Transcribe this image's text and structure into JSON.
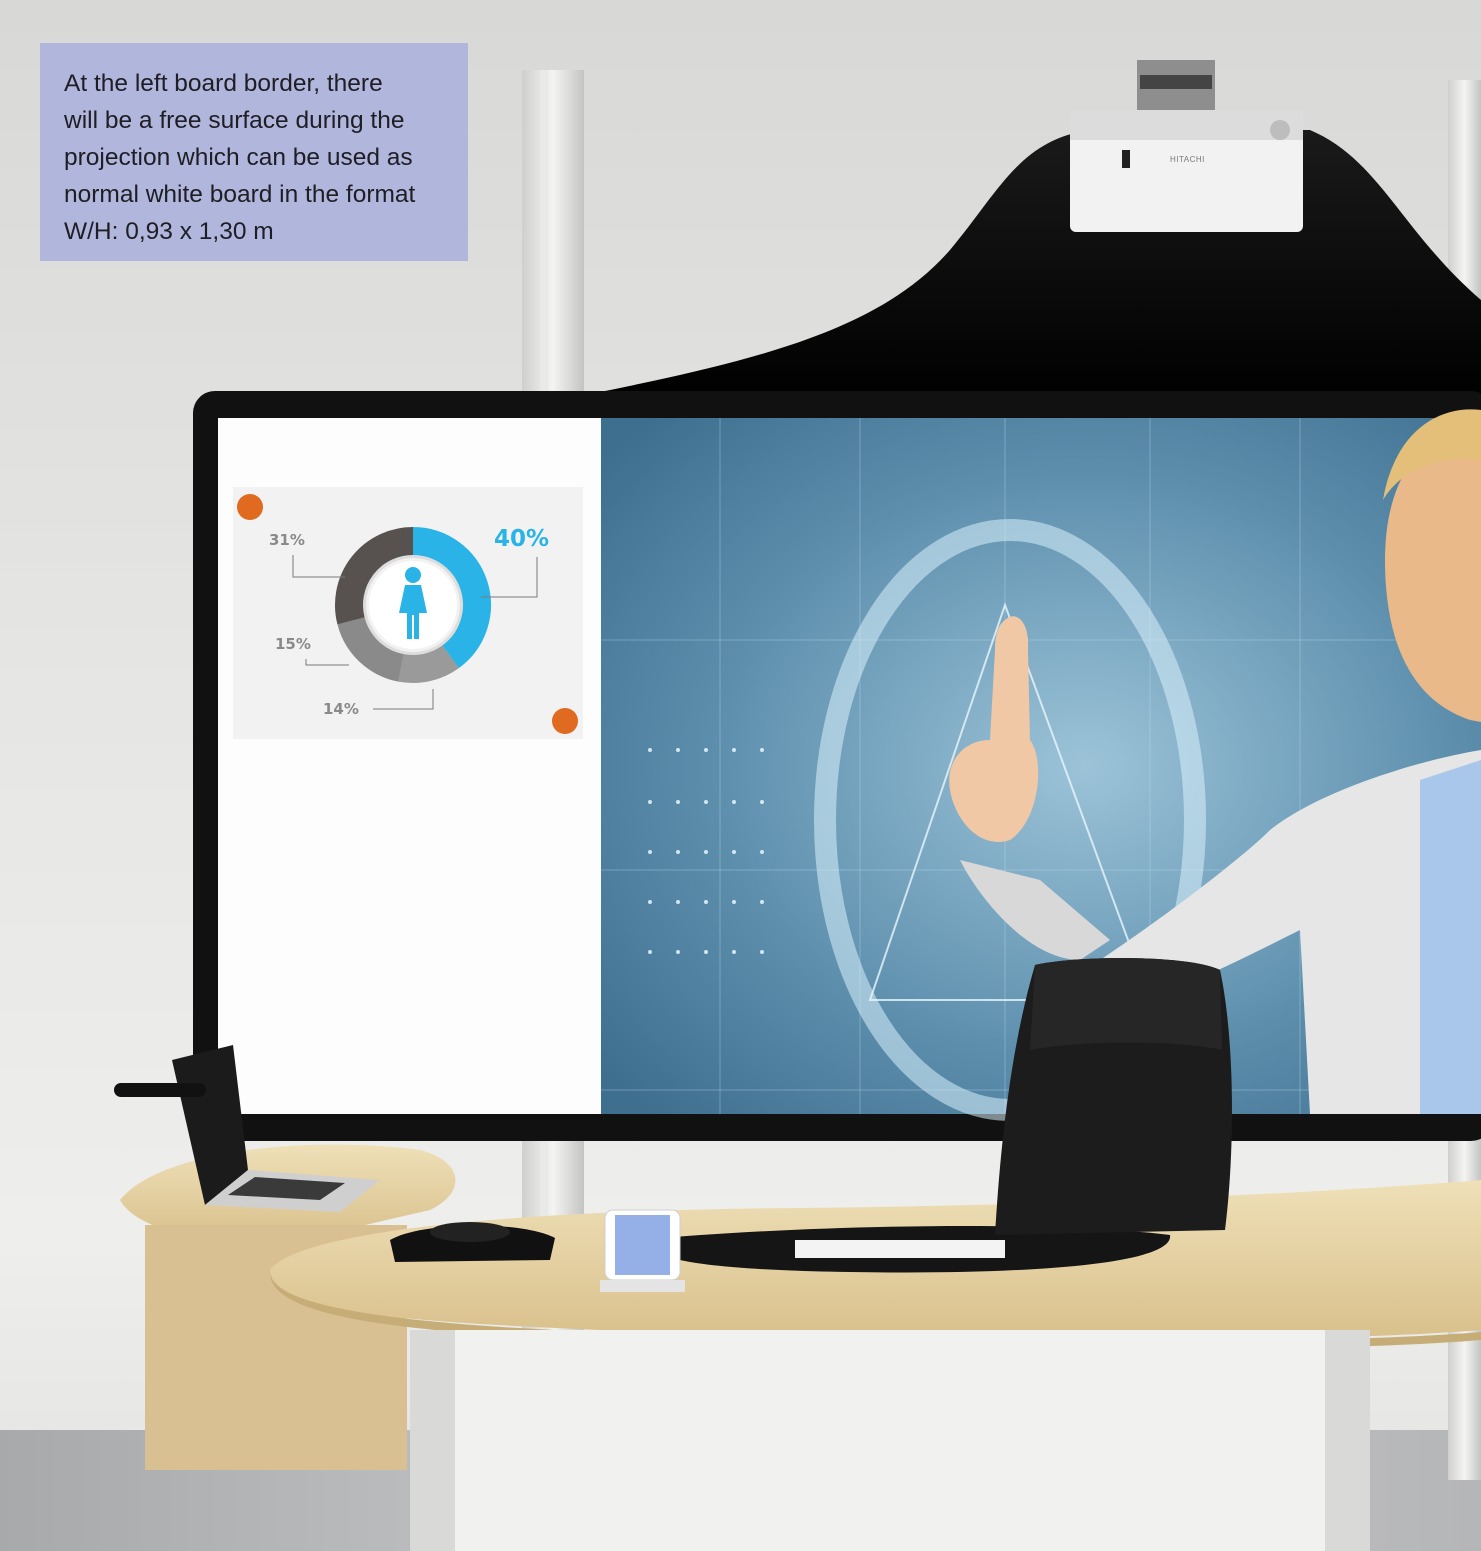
{
  "callout": {
    "text": "At the left board border, there\nwill be a free surface during the\nprojection which can be used as\nnormal white board in the format\nW/H: 0,93 x 1,30 m"
  },
  "projector": {
    "brand": "HITACHI"
  },
  "infographic": {
    "labels": [
      "31%",
      "40%",
      "15%",
      "14%"
    ],
    "icon": "woman-icon"
  },
  "colors": {
    "callout_bg": "#b1b6dd",
    "highlight_blue": "#2ab3e6",
    "dark_segment": "#57524f",
    "marker_orange": "#e06a1f",
    "desk_wood": "#e6d3a6"
  }
}
